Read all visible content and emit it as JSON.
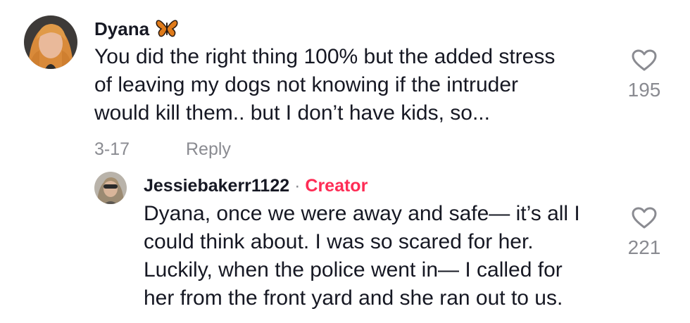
{
  "comments": [
    {
      "username": "Dyana",
      "emoji": "butterfly-emoji",
      "text_lines": [
        "You did the right thing 100% but the added stress",
        "of leaving my dogs not knowing if the intruder",
        "would kill them.. but I don’t have kids, so..."
      ],
      "date": "3-17",
      "reply_label": "Reply",
      "likes": "195"
    }
  ],
  "reply": {
    "username": "Jessiebakerr1122",
    "separator": "·",
    "badge": "Creator",
    "text_lines": [
      "Dyana, once we were away and safe— it’s all I",
      "could think about. I was so scared for her.",
      "Luckily, when the police went in— I called for",
      "her from the front yard and she ran out to us."
    ],
    "likes": "221"
  },
  "colors": {
    "text": "#161823",
    "muted": "#8a8b91",
    "creator": "#fe2c55",
    "background": "#ffffff"
  },
  "icons": [
    "heart-outline-icon",
    "butterfly-emoji"
  ]
}
